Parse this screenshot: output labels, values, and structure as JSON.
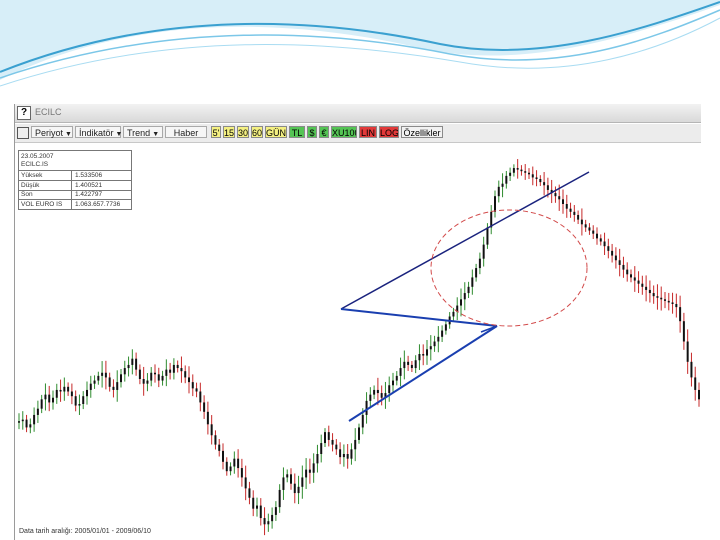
{
  "window": {
    "title": "ECILC"
  },
  "toolbar": {
    "periyot_label": "Periyot",
    "indikator_label": "İndikatör",
    "trend_label": "Trend",
    "haber_label": "Haber",
    "buttons": [
      {
        "label": "5'",
        "color": "#f4f082"
      },
      {
        "label": "15'",
        "color": "#f4f082"
      },
      {
        "label": "30'",
        "color": "#f4f082"
      },
      {
        "label": "60'",
        "color": "#f4f082"
      },
      {
        "label": "GÜN",
        "color": "#f4f082"
      },
      {
        "label": "TL",
        "color": "#54c454"
      },
      {
        "label": "$",
        "color": "#54c454"
      },
      {
        "label": "€",
        "color": "#54c454"
      },
      {
        "label": "XU100",
        "color": "#54c454"
      },
      {
        "label": "LIN",
        "color": "#e23a3a"
      },
      {
        "label": "LOG",
        "color": "#e23a3a"
      },
      {
        "label": "Özellikler",
        "color": "#f2f2f2"
      }
    ]
  },
  "info_box": {
    "date": "23.05.2007",
    "symbol": "ECILC.IS",
    "rows": [
      {
        "label": "Yüksek",
        "value": "1.533506"
      },
      {
        "label": "Düşük",
        "value": "1.400521"
      },
      {
        "label": "Son",
        "value": "1.422797"
      },
      {
        "label": "VOL EURO IS",
        "value": "1.063.657.7736"
      }
    ]
  },
  "footer": {
    "text": "Data tarih aralığı: 2005/01/01 - 2009/06/10"
  },
  "chart_data": {
    "type": "line",
    "title": "",
    "xlabel": "",
    "ylabel": "",
    "candle_color_up": "#2e8b2e",
    "candle_color_down": "#c62828",
    "series": [
      {
        "values": [
          24,
          25,
          20,
          22,
          28,
          32,
          38,
          41,
          36,
          39,
          44,
          43,
          46,
          43,
          40,
          34,
          35,
          40,
          44,
          48,
          50,
          53,
          55,
          52,
          46,
          44,
          49,
          54,
          58,
          60,
          64,
          57,
          51,
          48,
          50,
          55,
          54,
          50,
          53,
          57,
          55,
          60,
          58,
          56,
          52,
          49,
          45,
          43,
          36,
          30,
          22,
          15,
          9,
          5,
          -2,
          -8,
          -5,
          0,
          -6,
          -12,
          -19,
          -25,
          -32,
          -30,
          -38,
          -42,
          -40,
          -36,
          -31,
          -20,
          -12,
          -10,
          -16,
          -22,
          -18,
          -12,
          -7,
          -9,
          -3,
          3,
          10,
          17,
          12,
          9,
          6,
          1,
          3,
          0,
          6,
          12,
          20,
          28,
          37,
          41,
          44,
          42,
          39,
          42,
          47,
          50,
          53,
          58,
          62,
          60,
          58,
          63,
          67,
          66,
          70,
          72,
          75,
          78,
          82,
          86,
          91,
          94,
          98,
          102,
          106,
          110,
          116,
          122,
          128,
          137,
          148,
          158,
          168,
          174,
          176,
          181,
          183,
          186,
          185,
          184,
          183,
          182,
          180,
          179,
          177,
          175,
          172,
          170,
          168,
          166,
          163,
          160,
          158,
          156,
          153,
          150,
          148,
          146,
          144,
          141,
          139,
          136,
          133,
          130,
          127,
          124,
          121,
          118,
          116,
          114,
          112,
          110,
          108,
          106,
          104,
          103,
          102,
          101,
          100,
          99,
          97,
          88,
          75,
          62,
          52,
          44,
          38
        ]
      }
    ],
    "annotations": {
      "upper_trendline": [
        [
          16,
          75
        ],
        [
          127,
          186
        ]
      ],
      "lower_trendline": [
        [
          16,
          20
        ],
        [
          127,
          75
        ]
      ],
      "circle_label": ""
    }
  }
}
